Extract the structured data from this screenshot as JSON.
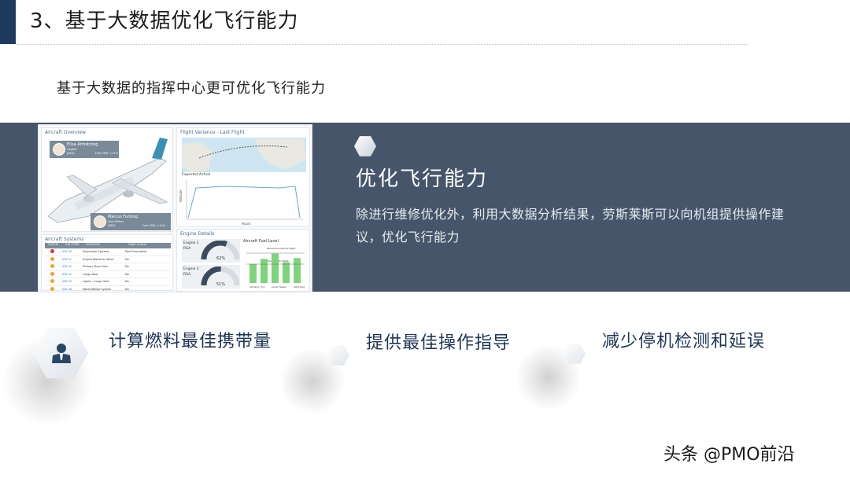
{
  "slide": {
    "title": "3、基于大数据优化飞行能力",
    "subtitle": "基于大数据的指挥中心更可优化飞行能力"
  },
  "dashboard": {
    "aircraft_overview": {
      "title": "Aircraft Overview",
      "captain_name": "Elisa Armstrong",
      "captain_role": "Captain",
      "captain_id": "(BEX)",
      "captain_fuel": "Fuel VSM: +11%",
      "fo_name": "Marcus Furlong",
      "fo_role": "First Officer",
      "fo_id": "(BEX)",
      "fo_fuel": "Fuel VSM: +11%"
    },
    "flight_variance": {
      "title": "Flight Variance - Last Flight",
      "legend_expected": "Expected",
      "legend_actual": "Actual",
      "x_label": "Hours",
      "y_label": "Altitude"
    },
    "aircraft_systems": {
      "title": "Aircraft Systems",
      "headers": [
        "STATUS",
        "ATA CODE",
        "LOCATION",
        "Flight Critical"
      ],
      "rows": [
        {
          "status_color": "#d9342b",
          "code": "ATA 00",
          "location": "Propulsion Systems",
          "critical": "Post Evacuation"
        },
        {
          "status_color": "#f0a030",
          "code": "ATA 21",
          "location": "Engine Bleed Air Valve",
          "critical": "No"
        },
        {
          "status_color": "#f0a030",
          "code": "ATA 32",
          "location": "Primary Door Seal",
          "critical": "No"
        },
        {
          "status_color": "#f0a030",
          "code": "ATA 52",
          "location": "Cargo Door",
          "critical": "No"
        },
        {
          "status_color": "#f0a030",
          "code": "ATA 33",
          "location": "Lights - Cargo Hold",
          "critical": "No"
        },
        {
          "status_color": "#f0a030",
          "code": "ATA 38",
          "location": "Water/Waste System",
          "critical": "No"
        }
      ]
    },
    "engine_details": {
      "title": "Engine Details",
      "engine1_label": "Engine 1",
      "engine1_model": "RSA",
      "engine1_value": "62%",
      "engine1_level": 0.62,
      "engine2_label": "Engine 2",
      "engine2_model": "RSA",
      "engine2_value": "51%",
      "engine2_level": 0.51
    },
    "fuel_level": {
      "title": "Aircraft Fuel Level",
      "note_top": "Recommended for flight",
      "note_bottom": "Minimum for flight",
      "bars": [
        0.55,
        0.7,
        0.85,
        0.6,
        0.72
      ],
      "bar_labels": [
        "Left Wing",
        "Trim",
        "Center Tank",
        "Aux",
        "Right Wing"
      ]
    }
  },
  "band": {
    "heading": "优化飞行能力",
    "body": "除进行维修优化外，利用大数据分析结果，劳斯莱斯可以向机组提供操作建议，优化飞行能力"
  },
  "features": [
    {
      "label": "计算燃料最佳携带量",
      "icon": "person-icon"
    },
    {
      "label": "提供最佳操作指导"
    },
    {
      "label": "减少停机检测和延误"
    }
  ],
  "watermark": "头条 @PMO前沿",
  "colors": {
    "band": "#465569",
    "accent": "#1f3a5f",
    "gauge": "#3b4a5c",
    "fuel_bar": "#7ed47a"
  }
}
